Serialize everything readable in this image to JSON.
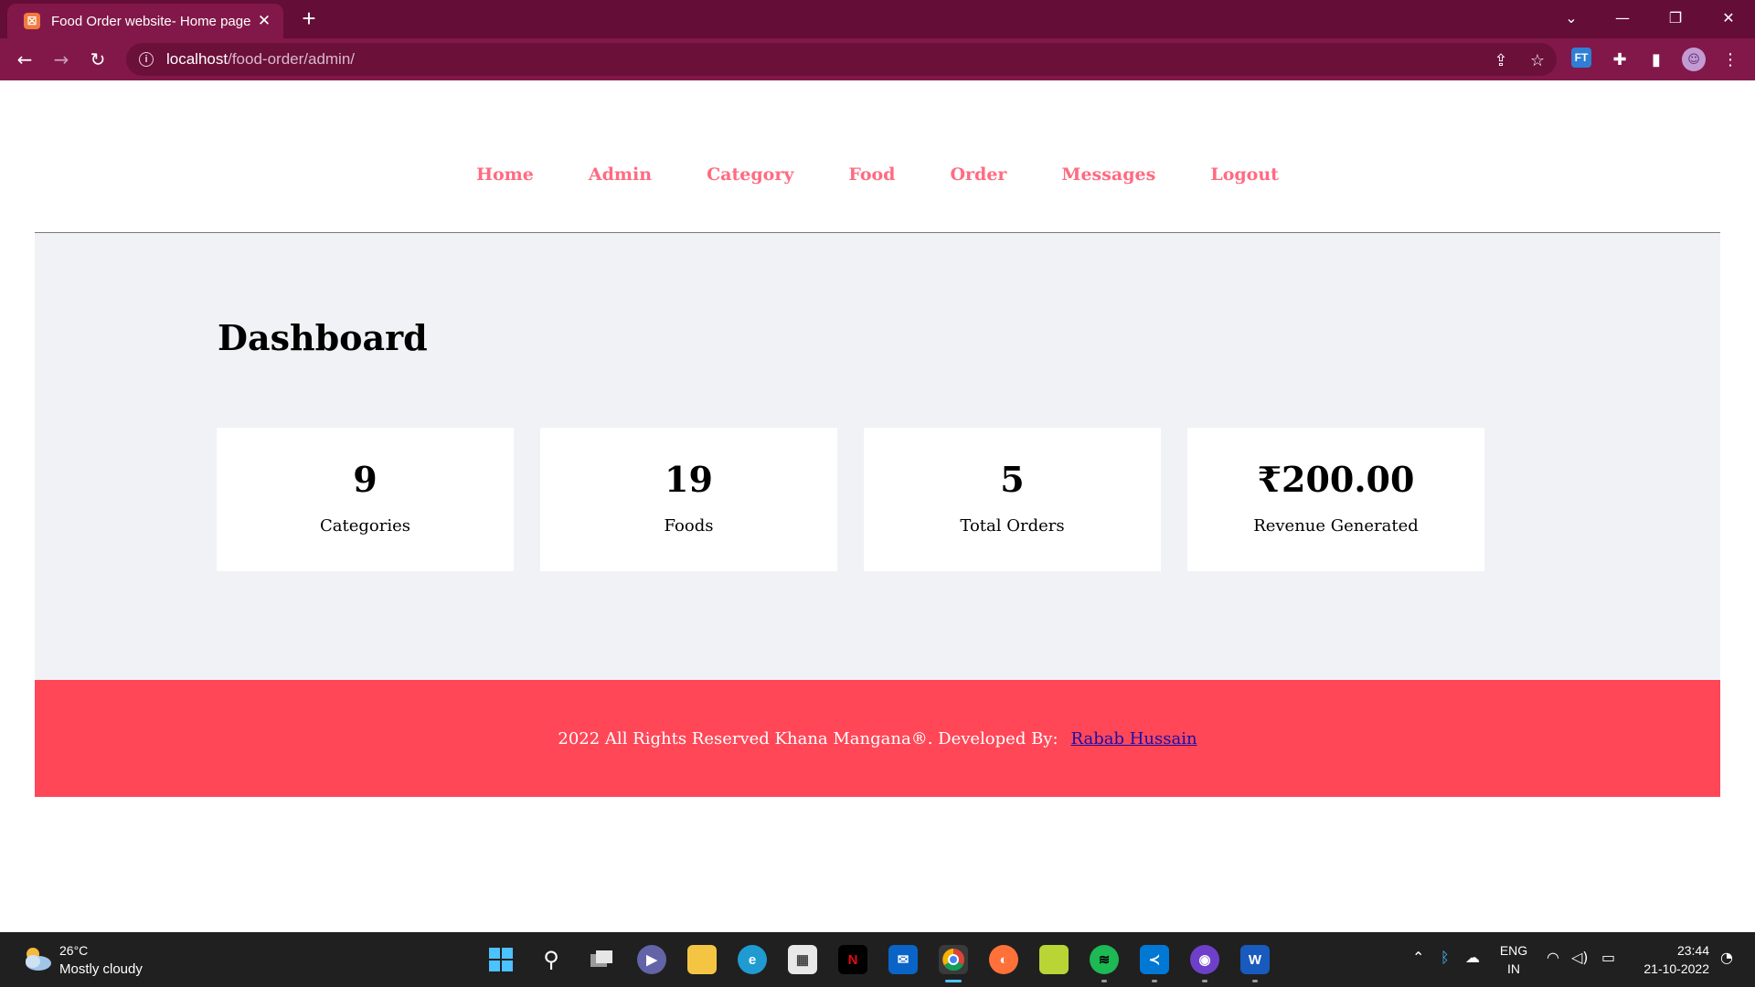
{
  "browser": {
    "tab_title": "Food Order website- Home page",
    "tab_close": "✕",
    "new_tab": "+",
    "url_host": "localhost",
    "url_path": "/food-order/admin/",
    "extension_badge": "FT"
  },
  "nav": {
    "items": [
      "Home",
      "Admin",
      "Category",
      "Food",
      "Order",
      "Messages",
      "Logout"
    ],
    "color": "#ff6b81"
  },
  "dashboard": {
    "title": "Dashboard",
    "cards": [
      {
        "value": "9",
        "label": "Categories"
      },
      {
        "value": "19",
        "label": "Foods"
      },
      {
        "value": "5",
        "label": "Total Orders"
      },
      {
        "value": "₹200.00",
        "label": "Revenue Generated"
      }
    ]
  },
  "footer": {
    "text": "2022 All Rights Reserved Khana Mangana®. Developed By:",
    "link_text": "Rabab Hussain",
    "background": "#ff4757"
  },
  "taskbar": {
    "weather_temp": "26°C",
    "weather_desc": "Mostly cloudy",
    "lang_top": "ENG",
    "lang_bottom": "IN",
    "time": "23:44",
    "date": "21-10-2022"
  },
  "colors": {
    "tab_strip": "#640d36",
    "toolbar": "#821849",
    "page_bg": "#f1f2f6"
  }
}
